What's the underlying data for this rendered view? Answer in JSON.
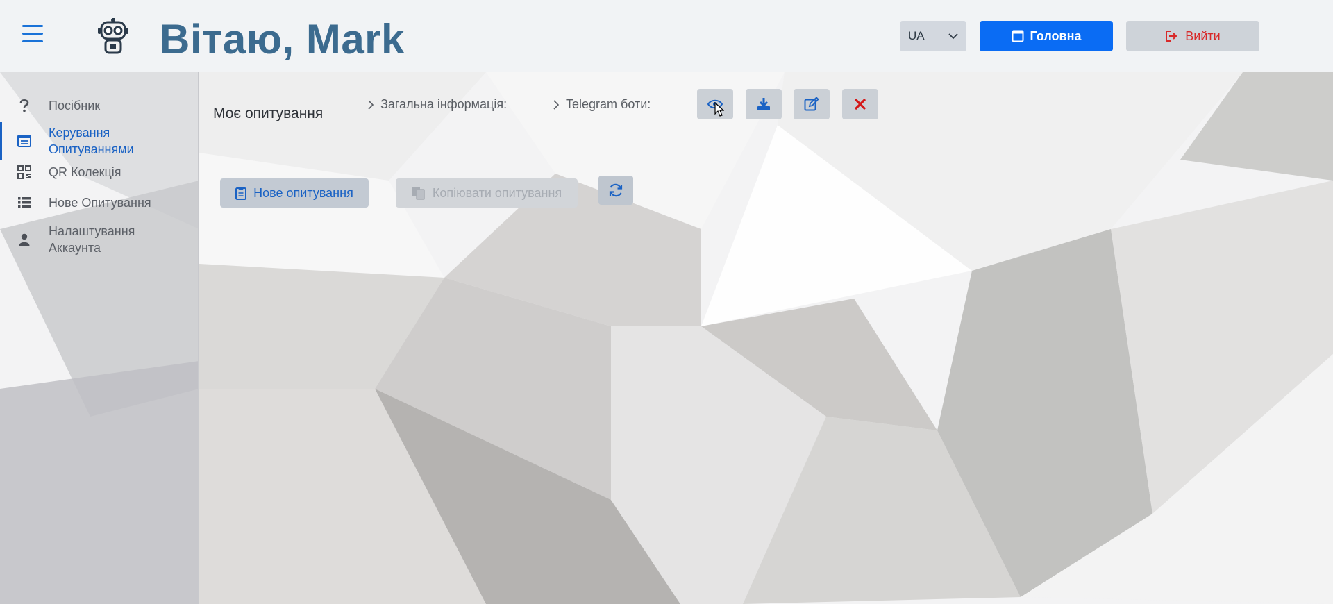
{
  "header": {
    "welcome": "Вітаю, Mark",
    "language": "UA",
    "home_label": "Головна",
    "logout_label": "Вийти"
  },
  "sidebar": {
    "items": [
      {
        "label": "Посібник",
        "icon": "question-icon"
      },
      {
        "label": "Керування Опитуваннями",
        "icon": "table-icon",
        "active": true
      },
      {
        "label": "QR Колекція",
        "icon": "qr-code-icon"
      },
      {
        "label": "Нове Опитування",
        "icon": "list-icon"
      },
      {
        "label": "Налаштування Аккаунта",
        "icon": "user-icon"
      }
    ]
  },
  "toolbar": {
    "title": "Моє опитування",
    "general_info": "Загальна інформація:",
    "telegram_bots": "Telegram боти:",
    "actions": [
      "eye-icon",
      "download-icon",
      "edit-icon",
      "delete-icon"
    ]
  },
  "actions": {
    "new_poll": "Нове опитування",
    "copy_poll": "Копіювати опитування",
    "refresh_icon": "refresh-icon"
  },
  "colors": {
    "accent": "#0a6cf4",
    "title": "#3c6b8f",
    "danger": "#d82a2a"
  }
}
